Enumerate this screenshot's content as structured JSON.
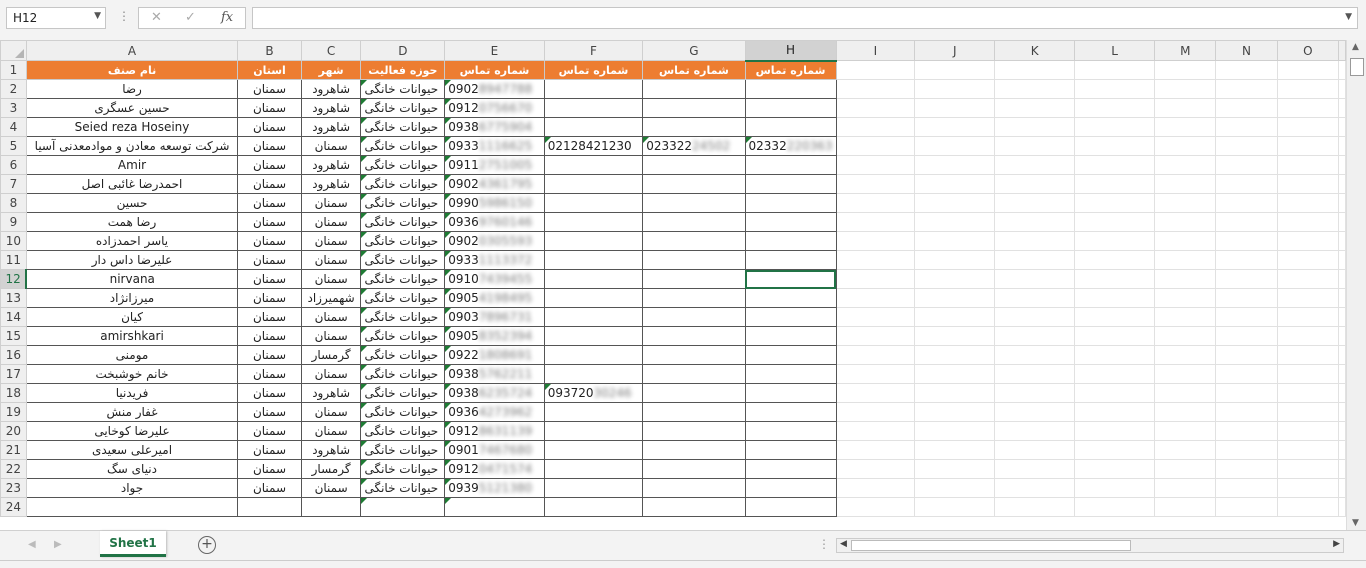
{
  "formula_bar": {
    "name_box": "H12",
    "fx": "fx",
    "formula": ""
  },
  "columns": [
    "A",
    "B",
    "C",
    "D",
    "E",
    "F",
    "G",
    "H",
    "I",
    "J",
    "K",
    "L",
    "M",
    "N",
    "O"
  ],
  "header_row": {
    "A": "نام صنف",
    "B": "استان",
    "C": "شهر",
    "D": "حوزه فعالیت",
    "E": "شماره تماس",
    "F": "شماره تماس",
    "G": "شماره تماس",
    "H": "شماره تماس"
  },
  "rows": [
    {
      "n": "2",
      "name": "رضا",
      "province": "سمنان",
      "city": "شاهرود",
      "field": "حیوانات خانگی",
      "p1": "0902",
      "p1b": "8947788"
    },
    {
      "n": "3",
      "name": "حسین عسگری",
      "province": "سمنان",
      "city": "شاهرود",
      "field": "حیوانات خانگی",
      "p1": "0912",
      "p1b": "0756670"
    },
    {
      "n": "4",
      "name": "Seied reza Hoseiny",
      "province": "سمنان",
      "city": "شاهرود",
      "field": "حیوانات خانگی",
      "p1": "0938",
      "p1b": "6775904"
    },
    {
      "n": "5",
      "name": "شرکت توسعه معادن و موادمعدنی آسیا",
      "province": "سمنان",
      "city": "سمنان",
      "field": "حیوانات خانگی",
      "p1": "0933",
      "p1b": "1116625",
      "p2": "02128421230",
      "p3": "023322",
      "p3b": "24502",
      "p4": "02332",
      "p4b": "220363"
    },
    {
      "n": "6",
      "name": "Amir",
      "province": "سمنان",
      "city": "شاهرود",
      "field": "حیوانات خانگی",
      "p1": "0911",
      "p1b": "2751005"
    },
    {
      "n": "7",
      "name": "احمدرضا غائبی اصل",
      "province": "سمنان",
      "city": "شاهرود",
      "field": "حیوانات خانگی",
      "p1": "0902",
      "p1b": "4361795"
    },
    {
      "n": "8",
      "name": "حسین",
      "province": "سمنان",
      "city": "سمنان",
      "field": "حیوانات خانگی",
      "p1": "0990",
      "p1b": "5986150"
    },
    {
      "n": "9",
      "name": "رضا همت",
      "province": "سمنان",
      "city": "سمنان",
      "field": "حیوانات خانگی",
      "p1": "0936",
      "p1b": "9760146"
    },
    {
      "n": "10",
      "name": "یاسر احمدزاده",
      "province": "سمنان",
      "city": "سمنان",
      "field": "حیوانات خانگی",
      "p1": "0902",
      "p1b": "0305593"
    },
    {
      "n": "11",
      "name": "علیرضا داس دار",
      "province": "سمنان",
      "city": "سمنان",
      "field": "حیوانات خانگی",
      "p1": "0933",
      "p1b": "1113372"
    },
    {
      "n": "12",
      "name": "nirvana",
      "province": "سمنان",
      "city": "سمنان",
      "field": "حیوانات خانگی",
      "p1": "0910",
      "p1b": "7439455"
    },
    {
      "n": "13",
      "name": "میرزانژاد",
      "province": "سمنان",
      "city": "شهمیرزاد",
      "field": "حیوانات خانگی",
      "p1": "0905",
      "p1b": "4198495"
    },
    {
      "n": "14",
      "name": "کیان",
      "province": "سمنان",
      "city": "سمنان",
      "field": "حیوانات خانگی",
      "p1": "0903",
      "p1b": "7896731"
    },
    {
      "n": "15",
      "name": "amirshkari",
      "province": "سمنان",
      "city": "سمنان",
      "field": "حیوانات خانگی",
      "p1": "0905",
      "p1b": "8352394"
    },
    {
      "n": "16",
      "name": "مومنی",
      "province": "سمنان",
      "city": "گرمسار",
      "field": "حیوانات خانگی",
      "p1": "0922",
      "p1b": "1808691"
    },
    {
      "n": "17",
      "name": "خانم خوشبخت",
      "province": "سمنان",
      "city": "سمنان",
      "field": "حیوانات خانگی",
      "p1": "0938",
      "p1b": "5762211"
    },
    {
      "n": "18",
      "name": "فریدنیا",
      "province": "سمنان",
      "city": "شاهرود",
      "field": "حیوانات خانگی",
      "p1": "0938",
      "p1b": "6235724",
      "p2": "093720",
      "p2b": "30246"
    },
    {
      "n": "19",
      "name": "غفار منش",
      "province": "سمنان",
      "city": "سمنان",
      "field": "حیوانات خانگی",
      "p1": "0936",
      "p1b": "4273962"
    },
    {
      "n": "20",
      "name": "علیرضا کوخایی",
      "province": "سمنان",
      "city": "سمنان",
      "field": "حیوانات خانگی",
      "p1": "0912",
      "p1b": "8631139"
    },
    {
      "n": "21",
      "name": "امیرعلی سعیدی",
      "province": "سمنان",
      "city": "شاهرود",
      "field": "حیوانات خانگی",
      "p1": "0901",
      "p1b": "7467680"
    },
    {
      "n": "22",
      "name": "دنیای سگ",
      "province": "سمنان",
      "city": "گرمسار",
      "field": "حیوانات خانگی",
      "p1": "0912",
      "p1b": "0471574"
    },
    {
      "n": "23",
      "name": "جواد",
      "province": "سمنان",
      "city": "سمنان",
      "field": "حیوانات خانگی",
      "p1": "0939",
      "p1b": "5121380"
    },
    {
      "n": "24",
      "name": "",
      "province": "",
      "city": "",
      "field": "",
      "p1": "",
      "p1b": ""
    }
  ],
  "active_cell": {
    "row": "12",
    "col": "H"
  },
  "sheet_tab": "Sheet1",
  "colors": {
    "header_fill": "#ed7d31",
    "accent": "#217346"
  }
}
